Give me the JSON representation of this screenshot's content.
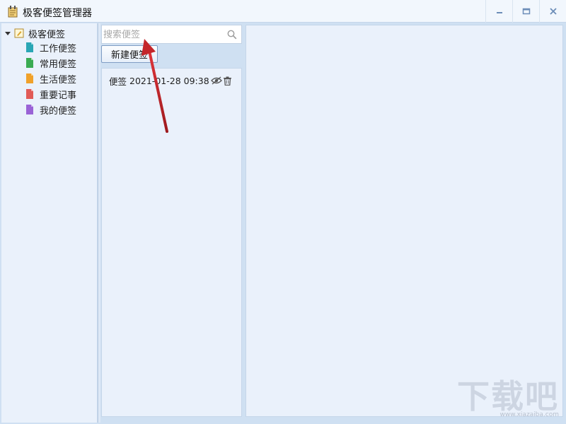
{
  "window": {
    "title": "极客便签管理器"
  },
  "sidebar": {
    "root": {
      "label": "极客便签",
      "expanded": true
    },
    "items": [
      {
        "label": "工作便签",
        "color": "#2aa6b5"
      },
      {
        "label": "常用便签",
        "color": "#3aab52"
      },
      {
        "label": "生活便签",
        "color": "#f0a12a"
      },
      {
        "label": "重要记事",
        "color": "#e15b57"
      },
      {
        "label": "我的便签",
        "color": "#9a63d6"
      }
    ]
  },
  "search": {
    "placeholder": "搜索便签",
    "value": ""
  },
  "toolbar": {
    "new_note_label": "新建便签"
  },
  "notes": [
    {
      "label": "便签",
      "timestamp": "2021-01-28 09:38"
    }
  ],
  "watermark": {
    "main": "下载吧",
    "sub": "www.xiazaiba.com"
  },
  "colors": {
    "accent": "#7f9dc4",
    "arrow": "#c4262a"
  }
}
